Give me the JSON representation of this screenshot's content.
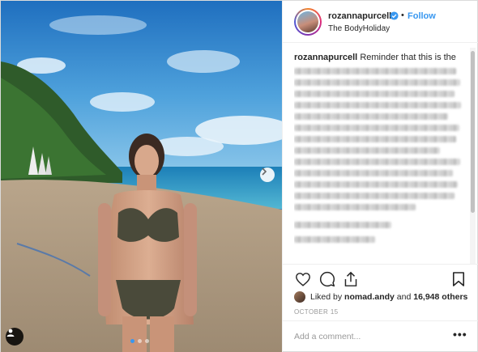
{
  "header": {
    "username": "rozannapurcell",
    "separator": "•",
    "follow_label": "Follow",
    "location": "The BodyHoliday"
  },
  "caption": {
    "username": "rozannapurcell",
    "text": "Reminder that this is the"
  },
  "engagement": {
    "liked_prefix": "Liked by ",
    "liked_user": "nomad.andy",
    "liked_mid": " and ",
    "liked_count": "16,948 others",
    "date": "OCTOBER 15"
  },
  "comment": {
    "placeholder": "Add a comment...",
    "more_label": "•••"
  },
  "carousel": {
    "total": 3,
    "active": 1
  },
  "colors": {
    "accent": "#3897f0",
    "text": "#262626",
    "muted": "#999999",
    "border": "#efefef"
  },
  "icons": [
    "verified-icon",
    "heart-icon",
    "comment-icon",
    "share-icon",
    "bookmark-icon",
    "chevron-right-icon",
    "user-tag-icon"
  ]
}
